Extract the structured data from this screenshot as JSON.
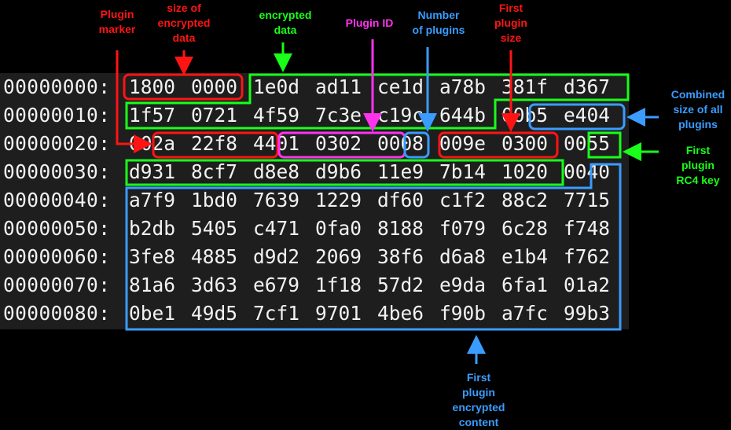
{
  "hexdump": {
    "rows": [
      {
        "addr": "00000000:",
        "groups": [
          "1800",
          "0000",
          "1e0d",
          "ad11",
          "ce1d",
          "a78b",
          "381f",
          "d367"
        ]
      },
      {
        "addr": "00000010:",
        "groups": [
          "1f57",
          "0721",
          "4f59",
          "7c3e",
          "c19c",
          "644b",
          "00b5",
          "e404"
        ]
      },
      {
        "addr": "00000020:",
        "groups": [
          "002a",
          "22f8",
          "4401",
          "0302",
          "0008",
          "009e",
          "0300",
          "0055"
        ]
      },
      {
        "addr": "00000030:",
        "groups": [
          "d931",
          "8cf7",
          "d8e8",
          "d9b6",
          "11e9",
          "7b14",
          "1020",
          "0040"
        ]
      },
      {
        "addr": "00000040:",
        "groups": [
          "a7f9",
          "1bd0",
          "7639",
          "1229",
          "df60",
          "c1f2",
          "88c2",
          "7715"
        ]
      },
      {
        "addr": "00000050:",
        "groups": [
          "b2db",
          "5405",
          "c471",
          "0fa0",
          "8188",
          "f079",
          "6c28",
          "f748"
        ]
      },
      {
        "addr": "00000060:",
        "groups": [
          "3fe8",
          "4885",
          "d9d2",
          "2069",
          "38f6",
          "d6a8",
          "e1b4",
          "f762"
        ]
      },
      {
        "addr": "00000070:",
        "groups": [
          "81a6",
          "3d63",
          "e679",
          "1f18",
          "57d2",
          "e9da",
          "6fa1",
          "01a2"
        ]
      },
      {
        "addr": "00000080:",
        "groups": [
          "0be1",
          "49d5",
          "7cf1",
          "9701",
          "4be6",
          "f90b",
          "a7fc",
          "99b3"
        ]
      }
    ]
  },
  "annotations": {
    "plugin_marker": "Plugin\nmarker",
    "size_encrypted": "size of\nencrypted\ndata",
    "encrypted_data": "encrypted\ndata",
    "plugin_id": "Plugin ID",
    "number_plugins": "Number\nof plugins",
    "first_plugin_size": "First\nplugin\nsize",
    "combined_size": "Combined\nsize of all\nplugins",
    "first_plugin_rc4": "First\nplugin\nRC4 key",
    "first_plugin_content": "First\nplugin\nencrypted\ncontent"
  },
  "colors": {
    "red": "#ff1414",
    "green": "#19ff19",
    "magenta": "#ff33ee",
    "blue": "#3a9cff",
    "panel": "#1e1e1e"
  }
}
